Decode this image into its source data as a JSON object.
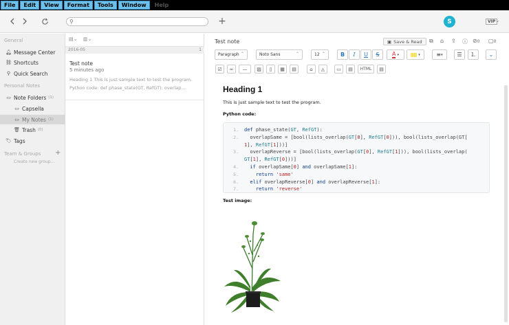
{
  "menubar": {
    "items": [
      "File",
      "Edit",
      "View",
      "Format",
      "Tools",
      "Window",
      "Help"
    ]
  },
  "toolbar": {
    "back_icon": "chevron-left-icon",
    "forward_icon": "chevron-right-icon",
    "sync_icon": "sync-icon",
    "new_note_icon": "plus-icon",
    "search_placeholder": "",
    "avatar_letter": "S",
    "vip_badge": "VIP"
  },
  "sidebar": {
    "general_label": "General",
    "general_items": [
      {
        "label": "Message Center",
        "icon": "bell-icon"
      },
      {
        "label": "Shortcuts",
        "icon": "link-icon"
      },
      {
        "label": "Quick Search",
        "icon": "search-icon"
      }
    ],
    "personal_label": "Personal Notes",
    "note_folders": {
      "label": "Note Folders",
      "count": "(1)"
    },
    "folders": [
      {
        "label": "Capsella",
        "count": ""
      },
      {
        "label": "My Notes",
        "count": "(1)"
      },
      {
        "label": "Trash",
        "count": "(0)"
      }
    ],
    "tags_label": "Tags",
    "team_label": "Team & Groups",
    "create_group": "Create new group..."
  },
  "notelist": {
    "date_header": "2016-05",
    "date_count": "1",
    "note": {
      "title": "Test note",
      "time": "5 minutes ago",
      "preview_line1": "Heading 1 This is just sample text to test the program.",
      "preview_line2": "Python code: def phase_state(GT, RefGT):   overlap..."
    }
  },
  "editor": {
    "title": "Test note",
    "save_read_label": "Save & Read",
    "attach_count": "0",
    "comment_count": "0",
    "format": {
      "paragraph": "Paragraph",
      "font": "Noto Sans",
      "size": "12",
      "html_label": "HTML"
    },
    "heading": "Heading 1",
    "intro": "This is just sample text to test the program.",
    "code_label": "Python code:",
    "code_lines": [
      {
        "n": "1.",
        "parts": [
          [
            "kw",
            "def "
          ],
          [
            "pl",
            "phase_state("
          ],
          [
            "nm",
            "GT"
          ],
          [
            "pl",
            ", "
          ],
          [
            "nm",
            "RefGT"
          ],
          [
            "pl",
            "):"
          ]
        ]
      },
      {
        "n": "2.",
        "parts": [
          [
            "pl",
            "  overlapSame = [bool(lists_overlap("
          ],
          [
            "nm",
            "GT"
          ],
          [
            "pl",
            "["
          ],
          [
            "st",
            "0"
          ],
          [
            "pl",
            "], "
          ],
          [
            "nm",
            "RefGT"
          ],
          [
            "pl",
            "["
          ],
          [
            "st",
            "0"
          ],
          [
            "pl",
            "])), bool(lists_overlap(GT["
          ]
        ]
      },
      {
        "n": "",
        "parts": [
          [
            "st",
            "1"
          ],
          [
            "pl",
            "], "
          ],
          [
            "nm",
            "RefGT"
          ],
          [
            "pl",
            "["
          ],
          [
            "st",
            "1"
          ],
          [
            "pl",
            "]))]"
          ]
        ]
      },
      {
        "n": "3.",
        "parts": [
          [
            "pl",
            "  overlapReverse = [bool(lists_overlap("
          ],
          [
            "nm",
            "GT"
          ],
          [
            "pl",
            "["
          ],
          [
            "st",
            "0"
          ],
          [
            "pl",
            "], "
          ],
          [
            "nm",
            "RefGT"
          ],
          [
            "pl",
            "["
          ],
          [
            "st",
            "1"
          ],
          [
            "pl",
            "])), bool(lists_overlap("
          ]
        ]
      },
      {
        "n": "",
        "parts": [
          [
            "nm",
            "GT"
          ],
          [
            "pl",
            "["
          ],
          [
            "st",
            "1"
          ],
          [
            "pl",
            "], "
          ],
          [
            "nm",
            "RefGT"
          ],
          [
            "pl",
            "["
          ],
          [
            "st",
            "0"
          ],
          [
            "pl",
            "]))]"
          ]
        ]
      },
      {
        "n": "4.",
        "parts": [
          [
            "kw",
            "  if "
          ],
          [
            "pl",
            "overlapSame["
          ],
          [
            "st",
            "0"
          ],
          [
            "pl",
            "] "
          ],
          [
            "kw",
            "and "
          ],
          [
            "pl",
            "overlapSame["
          ],
          [
            "st",
            "1"
          ],
          [
            "pl",
            "]:"
          ]
        ]
      },
      {
        "n": "5.",
        "parts": [
          [
            "kw",
            "    return "
          ],
          [
            "st",
            "'same'"
          ]
        ]
      },
      {
        "n": "6.",
        "parts": [
          [
            "kw",
            "  elif "
          ],
          [
            "pl",
            "overlapReverse["
          ],
          [
            "st",
            "0"
          ],
          [
            "pl",
            "] "
          ],
          [
            "kw",
            "and "
          ],
          [
            "pl",
            "overlapReverse["
          ],
          [
            "st",
            "1"
          ],
          [
            "pl",
            "]:"
          ]
        ]
      },
      {
        "n": "7.",
        "parts": [
          [
            "kw",
            "    return "
          ],
          [
            "st",
            "'reverse'"
          ]
        ]
      }
    ],
    "image_label": "Test image:"
  }
}
